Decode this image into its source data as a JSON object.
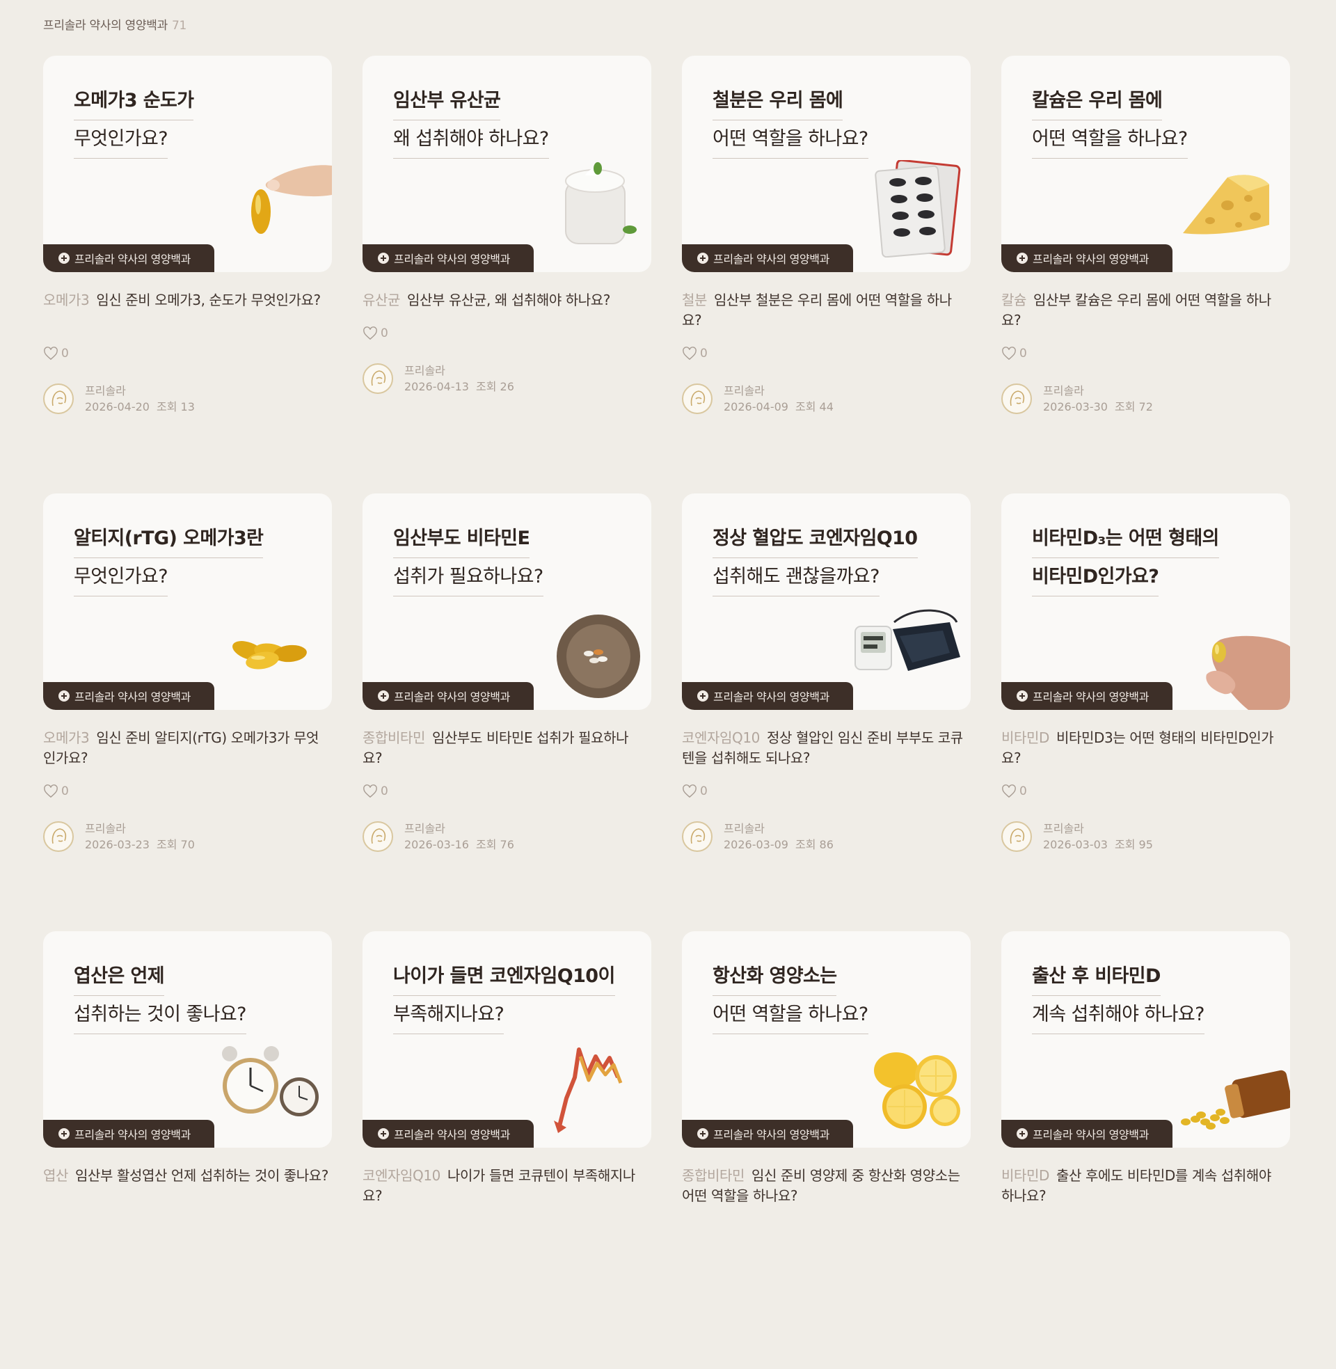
{
  "header": {
    "title": "프리솔라 약사의 영양백과",
    "count": "71"
  },
  "card_tag": "프리솔라 약사의 영양백과",
  "posts": [
    {
      "title_l1": "오메가3 순도가",
      "title_l2": "무엇인가요?",
      "category": "오메가3",
      "summary": "임신 준비 오메가3, 순도가 무엇인가요?",
      "likes": "0",
      "author": "프리솔라",
      "date": "2026-04-20",
      "views": "조회 13",
      "image": "omega3-capsule-fingers"
    },
    {
      "title_l1": "임산부 유산균",
      "title_l2": "왜 섭취해야 하나요?",
      "category": "유산균",
      "summary": "임산부 유산균, 왜 섭취해야 하나요?",
      "likes": "0",
      "author": "프리솔라",
      "date": "2026-04-13",
      "views": "조회 26",
      "image": "yogurt-jar"
    },
    {
      "title_l1": "철분은 우리 몸에",
      "title_l2": "어떤 역할을 하나요?",
      "category": "철분",
      "summary": "임산부 철분은 우리 몸에 어떤 역할을 하나요?",
      "likes": "0",
      "author": "프리솔라",
      "date": "2026-04-09",
      "views": "조회 44",
      "image": "pill-blister"
    },
    {
      "title_l1": "칼슘은 우리 몸에",
      "title_l2": "어떤 역할을 하나요?",
      "category": "칼슘",
      "summary": "임산부 칼슘은 우리 몸에 어떤 역할을 하나요?",
      "likes": "0",
      "author": "프리솔라",
      "date": "2026-03-30",
      "views": "조회 72",
      "image": "cheese-wedge"
    },
    {
      "title_l1": "알티지(rTG) 오메가3란",
      "title_l2": "무엇인가요?",
      "category": "오메가3",
      "summary": "임신 준비 알티지(rTG) 오메가3가 무엇인가요?",
      "likes": "0",
      "author": "프리솔라",
      "date": "2026-03-23",
      "views": "조회 70",
      "image": "softgel-capsules"
    },
    {
      "title_l1": "임산부도 비타민E",
      "title_l2": "섭취가 필요하나요?",
      "category": "종합비타민",
      "summary": "임산부도 비타민E 섭취가 필요하나요?",
      "likes": "0",
      "author": "프리솔라",
      "date": "2026-03-16",
      "views": "조회 76",
      "image": "pill-bowl"
    },
    {
      "title_l1": "정상 혈압도 코엔자임Q10",
      "title_l2": "섭취해도 괜찮을까요?",
      "category": "코엔자임Q10",
      "summary": "정상 혈압인 임신 준비 부부도 코큐텐을 섭취해도 되나요?",
      "likes": "0",
      "author": "프리솔라",
      "date": "2026-03-09",
      "views": "조회 86",
      "image": "blood-pressure-monitor"
    },
    {
      "title_l1": "비타민D₃는 어떤 형태의",
      "title_l2": "비타민D인가요?",
      "category": "비타민D",
      "summary": "비타민D3는 어떤 형태의 비타민D인가요?",
      "likes": "0",
      "author": "프리솔라",
      "date": "2026-03-03",
      "views": "조회 95",
      "image": "capsule-fingers"
    },
    {
      "title_l1": "엽산은 언제",
      "title_l2": "섭취하는 것이 좋나요?",
      "category": "엽산",
      "summary": "임산부 활성엽산 언제 섭취하는 것이 좋나요?",
      "likes": "",
      "author": "",
      "date": "",
      "views": "",
      "image": "alarm-clocks"
    },
    {
      "title_l1": "나이가 들면 코엔자임Q10이",
      "title_l2": "부족해지나요?",
      "category": "코엔자임Q10",
      "summary": "나이가 들면 코큐텐이 부족해지나요?",
      "likes": "",
      "author": "",
      "date": "",
      "views": "",
      "image": "declining-chart"
    },
    {
      "title_l1": "항산화 영양소는",
      "title_l2": "어떤 역할을 하나요?",
      "category": "종합비타민",
      "summary": "임신 준비 영양제 중 항산화 영양소는 어떤 역할을 하나요?",
      "likes": "",
      "author": "",
      "date": "",
      "views": "",
      "image": "lemon-slices"
    },
    {
      "title_l1": "출산 후 비타민D",
      "title_l2": "계속 섭취해야 하나요?",
      "category": "비타민D",
      "summary": "출산 후에도 비타민D를 계속 섭취해야 하나요?",
      "likes": "",
      "author": "",
      "date": "",
      "views": "",
      "image": "spilled-pill-bottle"
    }
  ]
}
